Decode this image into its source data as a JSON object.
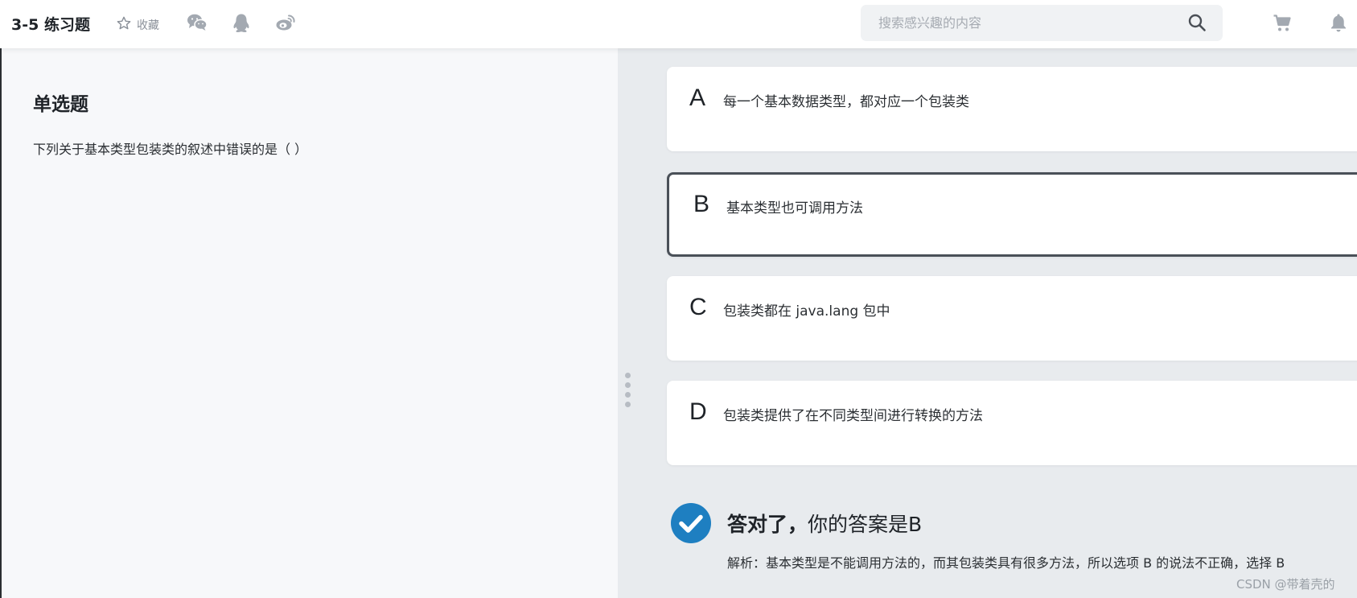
{
  "header": {
    "title": "3-5 练习题",
    "favorite_label": "收藏",
    "share_icons": [
      "wechat-icon",
      "qq-icon",
      "weibo-icon"
    ],
    "search": {
      "value": "",
      "placeholder": "搜索感兴趣的内容"
    },
    "right_icons": [
      "cart-icon",
      "bell-icon"
    ]
  },
  "question": {
    "type": "单选题",
    "text": "下列关于基本类型包装类的叙述中错误的是（ ）"
  },
  "options": [
    {
      "letter": "A",
      "text": "每一个基本数据类型，都对应一个包装类",
      "selected": false
    },
    {
      "letter": "B",
      "text": "基本类型也可调用方法",
      "selected": true
    },
    {
      "letter": "C",
      "text": "包装类都在 java.lang 包中",
      "selected": false
    },
    {
      "letter": "D",
      "text": "包装类提供了在不同类型间进行转换的方法",
      "selected": false
    }
  ],
  "result": {
    "correct_label": "答对了，",
    "answer_text": "你的答案是B",
    "analysis": "解析：基本类型是不能调用方法的，而其包装类具有很多方法，所以选项 B 的说法不正确，选择 B"
  },
  "watermark": "CSDN @带着壳的",
  "colors": {
    "accent": "#1e7fc1",
    "selected_border": "#4a5058",
    "icon_gray": "#8a9099"
  }
}
